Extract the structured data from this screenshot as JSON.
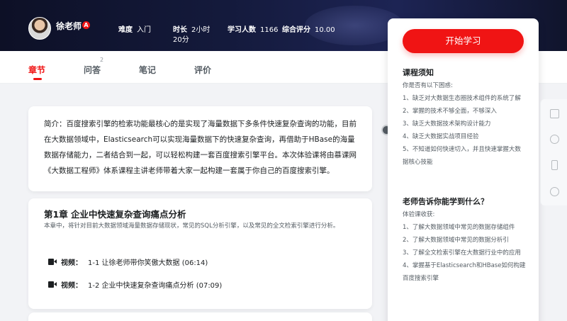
{
  "header": {
    "teacher_name": "徐老师",
    "teacher_badge": "A",
    "difficulty_label": "难度",
    "difficulty_value": "入门",
    "duration_label": "时长",
    "duration_value": "2小时20分",
    "students_label": "学习人数",
    "students_value": "1166",
    "rating_label": "综合评分",
    "rating_value": "10.00"
  },
  "tabs": [
    {
      "label": "章节",
      "active": true
    },
    {
      "label": "问答",
      "count": "2"
    },
    {
      "label": "笔记"
    },
    {
      "label": "评价"
    }
  ],
  "intro": {
    "text": "简介：百度搜索引擎的检索功能最核心的是实现了海量数据下多条件快速复杂查询的功能，目前在大数据领域中，Elasticsearch可以实现海量数据下的快速复杂查询，再借助于HBase的海量数据存储能力，二者结合到一起，可以轻松构建一套百度搜索引擎平台。本次体验课将由慕课网《大数据工程师》体系课程主讲老师带着大家一起构建一套属于你自己的百度搜索引擎。"
  },
  "chapter": {
    "title": "第1章 企业中快速复杂查询痛点分析",
    "description": "本章中，将针对目前大数据领域海量数据存储现状，常见的SQL分析引擎，以及常见的全文检索引擎进行分析。",
    "lessons": [
      {
        "type": "视频：",
        "title": "1-1 让徐老师带你笑傲大数据 (06:14)"
      },
      {
        "type": "视频：",
        "title": "1-2 企业中快速复杂查询痛点分析 (07:09)"
      }
    ]
  },
  "side_panel": {
    "start_button": "开始学习",
    "notice_heading": "课程须知",
    "notice_items": [
      "你是否有以下困惑:",
      "1、缺乏对大数据生态圈技术组件的系统了解",
      "2、掌握的技术不够全面，不够深入",
      "3、缺乏大数据技术架构设计能力",
      "4、缺乏大数据实战项目经验",
      "5、不知道如何快速切入，并且快速掌握大数据核心技能"
    ],
    "learn_heading": "老师告诉你能学到什么？",
    "learn_items": [
      "体验课收获:",
      "1、了解大数据领域中常见的数据存储组件",
      "2、了解大数据领域中常见的数据分析引",
      "3、了解全文检索引擎在大数据行业中的应用",
      "4、掌握基于Elasticsearch和HBase如何构建百度搜索引擎"
    ]
  },
  "icons": {
    "rail": [
      "feedback-icon",
      "help-icon",
      "phone-icon",
      "chat-icon"
    ],
    "lesson": "video-icon"
  },
  "colors": {
    "accent": "#f01414",
    "banner": "#141a3c"
  }
}
